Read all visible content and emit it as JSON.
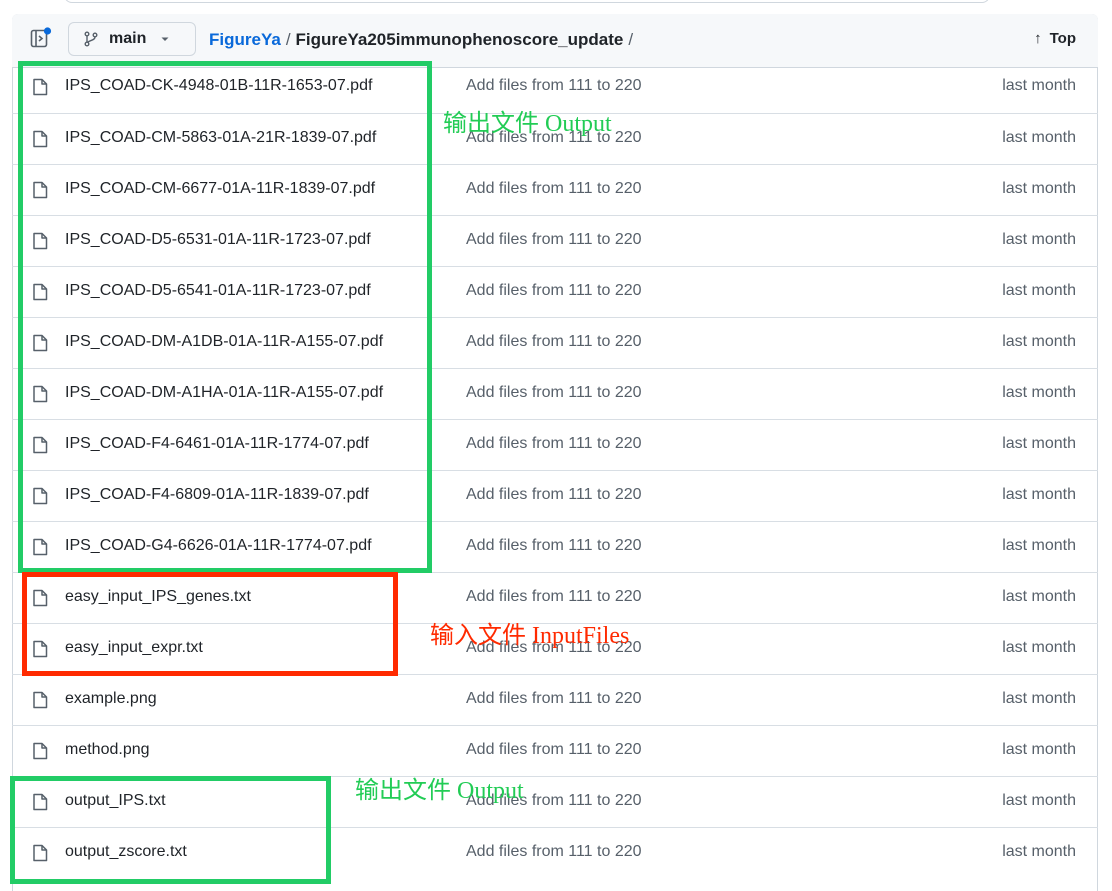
{
  "header": {
    "branch": "main",
    "breadcrumb": {
      "repo": "FigureYa",
      "separator": "/",
      "folder": "FigureYa205immunophenoscore_update",
      "trailing": "/"
    },
    "top_label": "Top",
    "top_arrow": "↑"
  },
  "files": [
    {
      "name": "IPS_COAD-CK-4948-01B-11R-1653-07.pdf",
      "commit": "Add files from 111 to 220",
      "time": "last month"
    },
    {
      "name": "IPS_COAD-CM-5863-01A-21R-1839-07.pdf",
      "commit": "Add files from 111 to 220",
      "time": "last month"
    },
    {
      "name": "IPS_COAD-CM-6677-01A-11R-1839-07.pdf",
      "commit": "Add files from 111 to 220",
      "time": "last month"
    },
    {
      "name": "IPS_COAD-D5-6531-01A-11R-1723-07.pdf",
      "commit": "Add files from 111 to 220",
      "time": "last month"
    },
    {
      "name": "IPS_COAD-D5-6541-01A-11R-1723-07.pdf",
      "commit": "Add files from 111 to 220",
      "time": "last month"
    },
    {
      "name": "IPS_COAD-DM-A1DB-01A-11R-A155-07.pdf",
      "commit": "Add files from 111 to 220",
      "time": "last month"
    },
    {
      "name": "IPS_COAD-DM-A1HA-01A-11R-A155-07.pdf",
      "commit": "Add files from 111 to 220",
      "time": "last month"
    },
    {
      "name": "IPS_COAD-F4-6461-01A-11R-1774-07.pdf",
      "commit": "Add files from 111 to 220",
      "time": "last month"
    },
    {
      "name": "IPS_COAD-F4-6809-01A-11R-1839-07.pdf",
      "commit": "Add files from 111 to 220",
      "time": "last month"
    },
    {
      "name": "IPS_COAD-G4-6626-01A-11R-1774-07.pdf",
      "commit": "Add files from 111 to 220",
      "time": "last month"
    },
    {
      "name": "easy_input_IPS_genes.txt",
      "commit": "Add files from 111 to 220",
      "time": "last month"
    },
    {
      "name": "easy_input_expr.txt",
      "commit": "Add files from 111 to 220",
      "time": "last month"
    },
    {
      "name": "example.png",
      "commit": "Add files from 111 to 220",
      "time": "last month"
    },
    {
      "name": "method.png",
      "commit": "Add files from 111 to 220",
      "time": "last month"
    },
    {
      "name": "output_IPS.txt",
      "commit": "Add files from 111 to 220",
      "time": "last month"
    },
    {
      "name": "output_zscore.txt",
      "commit": "Add files from 111 to 220",
      "time": "last month"
    }
  ],
  "annotations": {
    "output_top": "输出文件 Output",
    "input": "输入文件 InputFiles",
    "output_bottom": "输出文件 Output"
  },
  "colors": {
    "link": "#0969da",
    "muted": "#57606a",
    "annotation_green": "#22cc55",
    "annotation_red": "#ff2a00"
  },
  "icons": {
    "sidebar": "sidebar-expand-icon",
    "branch": "git-branch-icon",
    "caret": "triangle-down-icon",
    "file": "file-icon"
  }
}
